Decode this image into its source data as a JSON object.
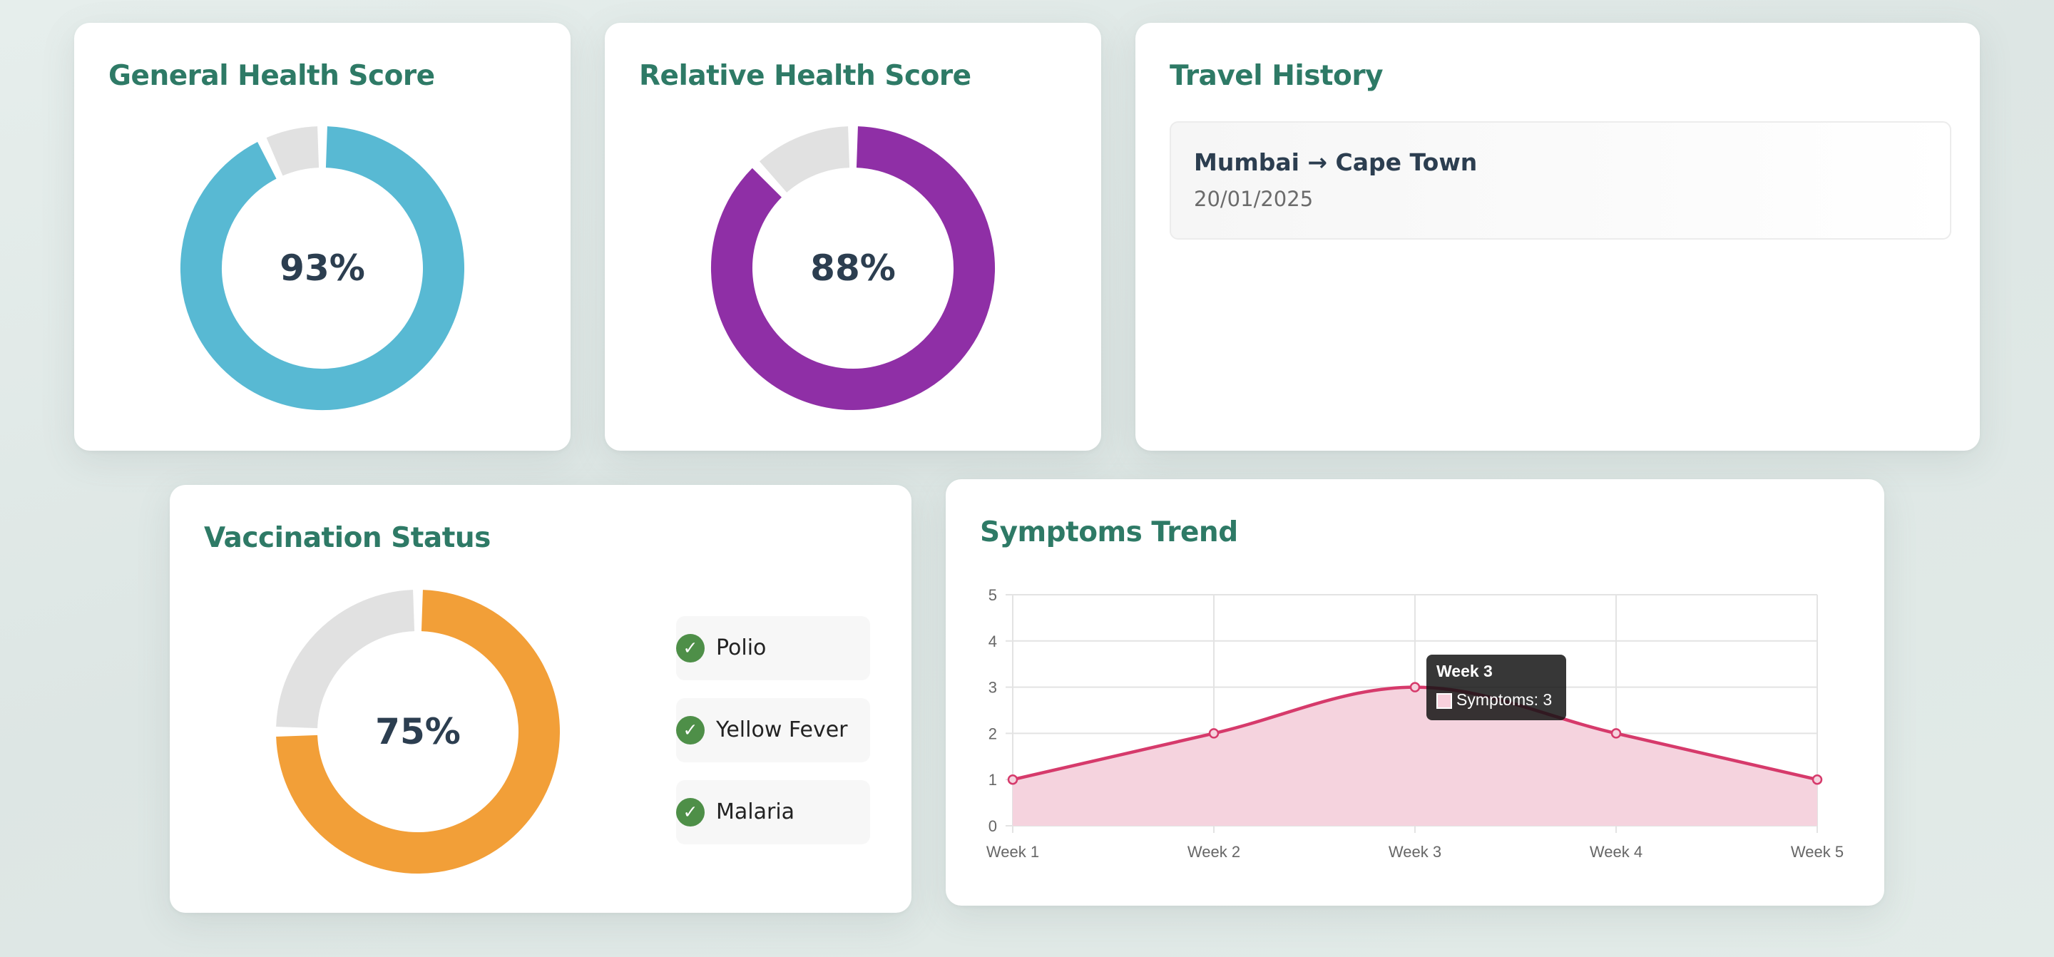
{
  "general_health": {
    "title": "General Health Score",
    "value_label": "93%",
    "value": 93,
    "color": "#58b9d3",
    "track_color": "#e1e1e1"
  },
  "relative_health": {
    "title": "Relative Health Score",
    "value_label": "88%",
    "value": 88,
    "color": "#8f2fa6",
    "track_color": "#e1e1e1"
  },
  "travel_history": {
    "title": "Travel History",
    "trips": [
      {
        "route": "Mumbai → Cape Town",
        "date": "20/01/2025"
      }
    ]
  },
  "vaccination": {
    "title": "Vaccination Status",
    "value_label": "75%",
    "value": 75,
    "color": "#f29f38",
    "track_color": "#e1e1e1",
    "check_color": "#4e8f48",
    "check_icon": "checkmark-icon",
    "vaccines": [
      {
        "name": "Polio",
        "check": "✓"
      },
      {
        "name": "Yellow Fever",
        "check": "✓"
      },
      {
        "name": "Malaria",
        "check": "✓"
      }
    ]
  },
  "symptoms": {
    "title": "Symptoms Trend",
    "tooltip": {
      "title": "Week 3",
      "body": "Symptoms: 3"
    }
  },
  "chart_data": {
    "type": "area",
    "title": "Symptoms Trend",
    "categories": [
      "Week 1",
      "Week 2",
      "Week 3",
      "Week 4",
      "Week 5"
    ],
    "series": [
      {
        "name": "Symptoms",
        "values": [
          1,
          2,
          3,
          2,
          1
        ],
        "color": "#d63a6b",
        "fill": "#f5d3de"
      }
    ],
    "ylim": [
      0,
      5
    ],
    "yticks": [
      "0",
      "1",
      "2",
      "3",
      "4",
      "5"
    ],
    "grid": true,
    "xlabel": "",
    "ylabel": ""
  }
}
